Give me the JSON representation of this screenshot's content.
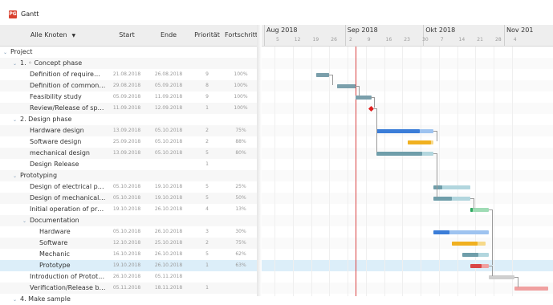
{
  "window": {
    "app_icon": "PG",
    "title": "Gantt"
  },
  "columns": {
    "name": "Alle Knoten",
    "start": "Start",
    "end": "Ende",
    "priority": "Priorität",
    "progress": "Fortschritt"
  },
  "timeline": {
    "months": [
      "Aug 2018",
      "Sep 2018",
      "Okt 2018",
      "Nov 201"
    ],
    "weeks": [
      "5",
      "12",
      "19",
      "26",
      "2",
      "9",
      "16",
      "23",
      "30",
      "7",
      "14",
      "21",
      "28",
      "4"
    ]
  },
  "rows": [
    {
      "level": 0,
      "toggle": "⌄",
      "name": "Project",
      "start": "",
      "end": "",
      "priority": "",
      "progress": ""
    },
    {
      "level": 1,
      "toggle": "⌄",
      "name": "1. ◦ Concept phase",
      "start": "",
      "end": "",
      "priority": "",
      "progress": ""
    },
    {
      "level": 2,
      "toggle": "",
      "name": "Definition of require…",
      "start": "21.08.2018",
      "end": "26.08.2018",
      "priority": "9",
      "progress": "100%"
    },
    {
      "level": 2,
      "toggle": "",
      "name": "Definition of common…",
      "start": "29.08.2018",
      "end": "05.09.2018",
      "priority": "8",
      "progress": "100%"
    },
    {
      "level": 2,
      "toggle": "",
      "name": "Feasibility study",
      "start": "05.09.2018",
      "end": "11.09.2018",
      "priority": "9",
      "progress": "100%"
    },
    {
      "level": 2,
      "toggle": "",
      "name": "Review/Release of spec…",
      "start": "11.09.2018",
      "end": "12.09.2018",
      "priority": "1",
      "progress": "100%"
    },
    {
      "level": 1,
      "toggle": "⌄",
      "name": "2. Design phase",
      "start": "",
      "end": "",
      "priority": "",
      "progress": ""
    },
    {
      "level": 2,
      "toggle": "",
      "name": "Hardware design",
      "start": "13.09.2018",
      "end": "05.10.2018",
      "priority": "2",
      "progress": "75%"
    },
    {
      "level": 2,
      "toggle": "",
      "name": "Software design",
      "start": "25.09.2018",
      "end": "05.10.2018",
      "priority": "2",
      "progress": "88%"
    },
    {
      "level": 2,
      "toggle": "",
      "name": "mechanical design",
      "start": "13.09.2018",
      "end": "05.10.2018",
      "priority": "5",
      "progress": "80%"
    },
    {
      "level": 2,
      "toggle": "",
      "name": "Design Release",
      "start": "",
      "end": "",
      "priority": "1",
      "progress": ""
    },
    {
      "level": 1,
      "toggle": "⌄",
      "name": "Prototyping",
      "start": "",
      "end": "",
      "priority": "",
      "progress": ""
    },
    {
      "level": 2,
      "toggle": "",
      "name": "Design of electrical p…",
      "start": "05.10.2018",
      "end": "19.10.2018",
      "priority": "5",
      "progress": "25%"
    },
    {
      "level": 2,
      "toggle": "",
      "name": "Design of mechanical…",
      "start": "05.10.2018",
      "end": "19.10.2018",
      "priority": "5",
      "progress": "50%"
    },
    {
      "level": 2,
      "toggle": "",
      "name": "Initial operation of pr…",
      "start": "19.10.2018",
      "end": "26.10.2018",
      "priority": "4",
      "progress": "13%"
    },
    {
      "level": 2,
      "toggle": "⌄",
      "name": "Documentation",
      "start": "",
      "end": "",
      "priority": "",
      "progress": ""
    },
    {
      "level": 3,
      "toggle": "",
      "name": "Hardware",
      "start": "05.10.2018",
      "end": "26.10.2018",
      "priority": "3",
      "progress": "30%"
    },
    {
      "level": 3,
      "toggle": "",
      "name": "Software",
      "start": "12.10.2018",
      "end": "25.10.2018",
      "priority": "2",
      "progress": "75%"
    },
    {
      "level": 3,
      "toggle": "",
      "name": "Mechanic",
      "start": "16.10.2018",
      "end": "26.10.2018",
      "priority": "5",
      "progress": "62%"
    },
    {
      "level": 3,
      "toggle": "",
      "name": "Prototype",
      "start": "19.10.2018",
      "end": "26.10.2018",
      "priority": "1",
      "progress": "63%",
      "selected": true
    },
    {
      "level": 2,
      "toggle": "",
      "name": "Introduction of Prototype",
      "start": "26.10.2018",
      "end": "05.11.2018",
      "priority": "",
      "progress": ""
    },
    {
      "level": 2,
      "toggle": "",
      "name": "Verification/Release b…",
      "start": "05.11.2018",
      "end": "18.11.2018",
      "priority": "1",
      "progress": ""
    },
    {
      "level": 1,
      "toggle": "⌄",
      "name": "4. Make sample",
      "start": "",
      "end": "",
      "priority": "",
      "progress": ""
    }
  ],
  "colors": {
    "done": "#7a9fab",
    "hardware": "#3b7dd8",
    "hardware_rest": "#9ec3f0",
    "software": "#f0b020",
    "software_rest": "#f6d98a",
    "mechanical": "#6f9eaa",
    "mechanical_rest": "#b2d6de",
    "init_done": "#2fa860",
    "init_rest": "#9fdcb5",
    "proto": "#d94545",
    "proto_rest": "#f0a0a0",
    "intro": "#cfcfcf",
    "milestone": "#e02020",
    "today": "#d94040"
  },
  "chart_data": {
    "type": "gantt",
    "today": "11.09.2018",
    "tasks": [
      {
        "name": "Definition of require…",
        "start": "21.08.2018",
        "end": "26.08.2018",
        "progress": 1.0
      },
      {
        "name": "Definition of common…",
        "start": "29.08.2018",
        "end": "05.09.2018",
        "progress": 1.0
      },
      {
        "name": "Feasibility study",
        "start": "05.09.2018",
        "end": "11.09.2018",
        "progress": 1.0
      },
      {
        "name": "Review/Release of spec…",
        "start": "11.09.2018",
        "end": "12.09.2018",
        "progress": 1.0,
        "milestone": true
      },
      {
        "name": "Hardware design",
        "start": "13.09.2018",
        "end": "05.10.2018",
        "progress": 0.75
      },
      {
        "name": "Software design",
        "start": "25.09.2018",
        "end": "05.10.2018",
        "progress": 0.88
      },
      {
        "name": "mechanical design",
        "start": "13.09.2018",
        "end": "05.10.2018",
        "progress": 0.8
      },
      {
        "name": "Design of electrical p…",
        "start": "05.10.2018",
        "end": "19.10.2018",
        "progress": 0.25
      },
      {
        "name": "Design of mechanical…",
        "start": "05.10.2018",
        "end": "19.10.2018",
        "progress": 0.5
      },
      {
        "name": "Initial operation of pr…",
        "start": "19.10.2018",
        "end": "26.10.2018",
        "progress": 0.13
      },
      {
        "name": "Hardware",
        "start": "05.10.2018",
        "end": "26.10.2018",
        "progress": 0.3
      },
      {
        "name": "Software",
        "start": "12.10.2018",
        "end": "25.10.2018",
        "progress": 0.75
      },
      {
        "name": "Mechanic",
        "start": "16.10.2018",
        "end": "26.10.2018",
        "progress": 0.62
      },
      {
        "name": "Prototype",
        "start": "19.10.2018",
        "end": "26.10.2018",
        "progress": 0.63
      },
      {
        "name": "Introduction of Prototype",
        "start": "26.10.2018",
        "end": "05.11.2018",
        "progress": 0
      },
      {
        "name": "Verification/Release b…",
        "start": "05.11.2018",
        "end": "18.11.2018",
        "progress": 0
      }
    ]
  }
}
